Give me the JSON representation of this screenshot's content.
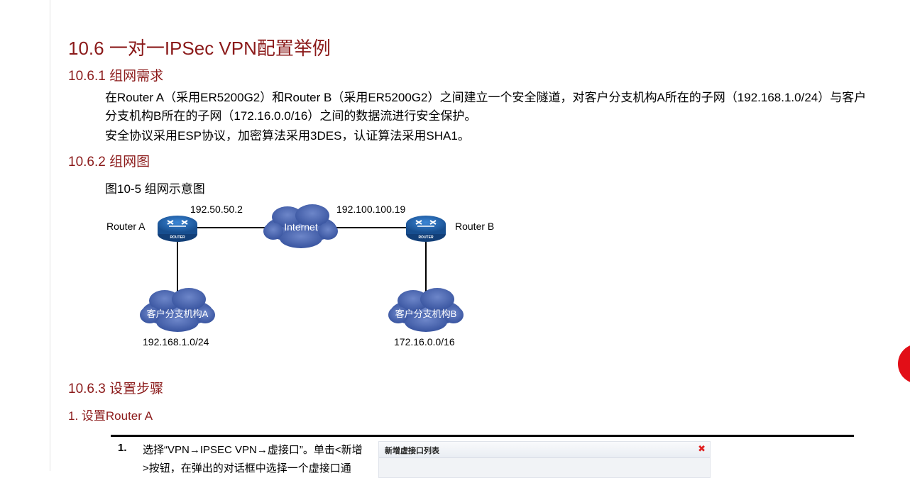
{
  "section": {
    "heading": "10.6  一对一IPSec VPN配置举例",
    "sub1": "10.6.1  组网需求",
    "para1_line1": "在Router A（采用ER5200G2）和Router B（采用ER5200G2）之间建立一个安全隧道，对客户分支机构A所在的子网（192.168.1.0/24）与客户",
    "para1_line2": "分支机构B所在的子网（172.16.0.0/16）之间的数据流进行安全保护。",
    "para2": "安全协议采用ESP协议，加密算法采用3DES，认证算法采用SHA1。",
    "sub2": "10.6.2  组网图",
    "figure_title": "图10-5 组网示意图",
    "sub3": "10.6.3  设置步骤",
    "sub4": "1. 设置Router A"
  },
  "diagram": {
    "router_a_label": "Router A",
    "router_b_label": "Router B",
    "router_badge": "ROUTER",
    "ip_a": "192.50.50.2",
    "ip_b": "192.100.100.19",
    "internet": "Internet",
    "branch_a": "客户分支机构A",
    "branch_b": "客户分支机构B",
    "subnet_a": "192.168.1.0/24",
    "subnet_b": "172.16.0.0/16"
  },
  "steps": [
    {
      "num": "1.",
      "text_line1": "选择“VPN→IPSEC VPN→虚接口”。单击<新增",
      "text_line2": ">按钮，在弹出的对话框中选择一个虚接口通"
    }
  ],
  "dialog": {
    "title": "新增虚接口列表",
    "close_glyph": "✖"
  },
  "colors": {
    "heading": "#8b1a1a",
    "router": "#1f5fa5",
    "cloud": "#3f5ca8",
    "close": "#e02020"
  }
}
